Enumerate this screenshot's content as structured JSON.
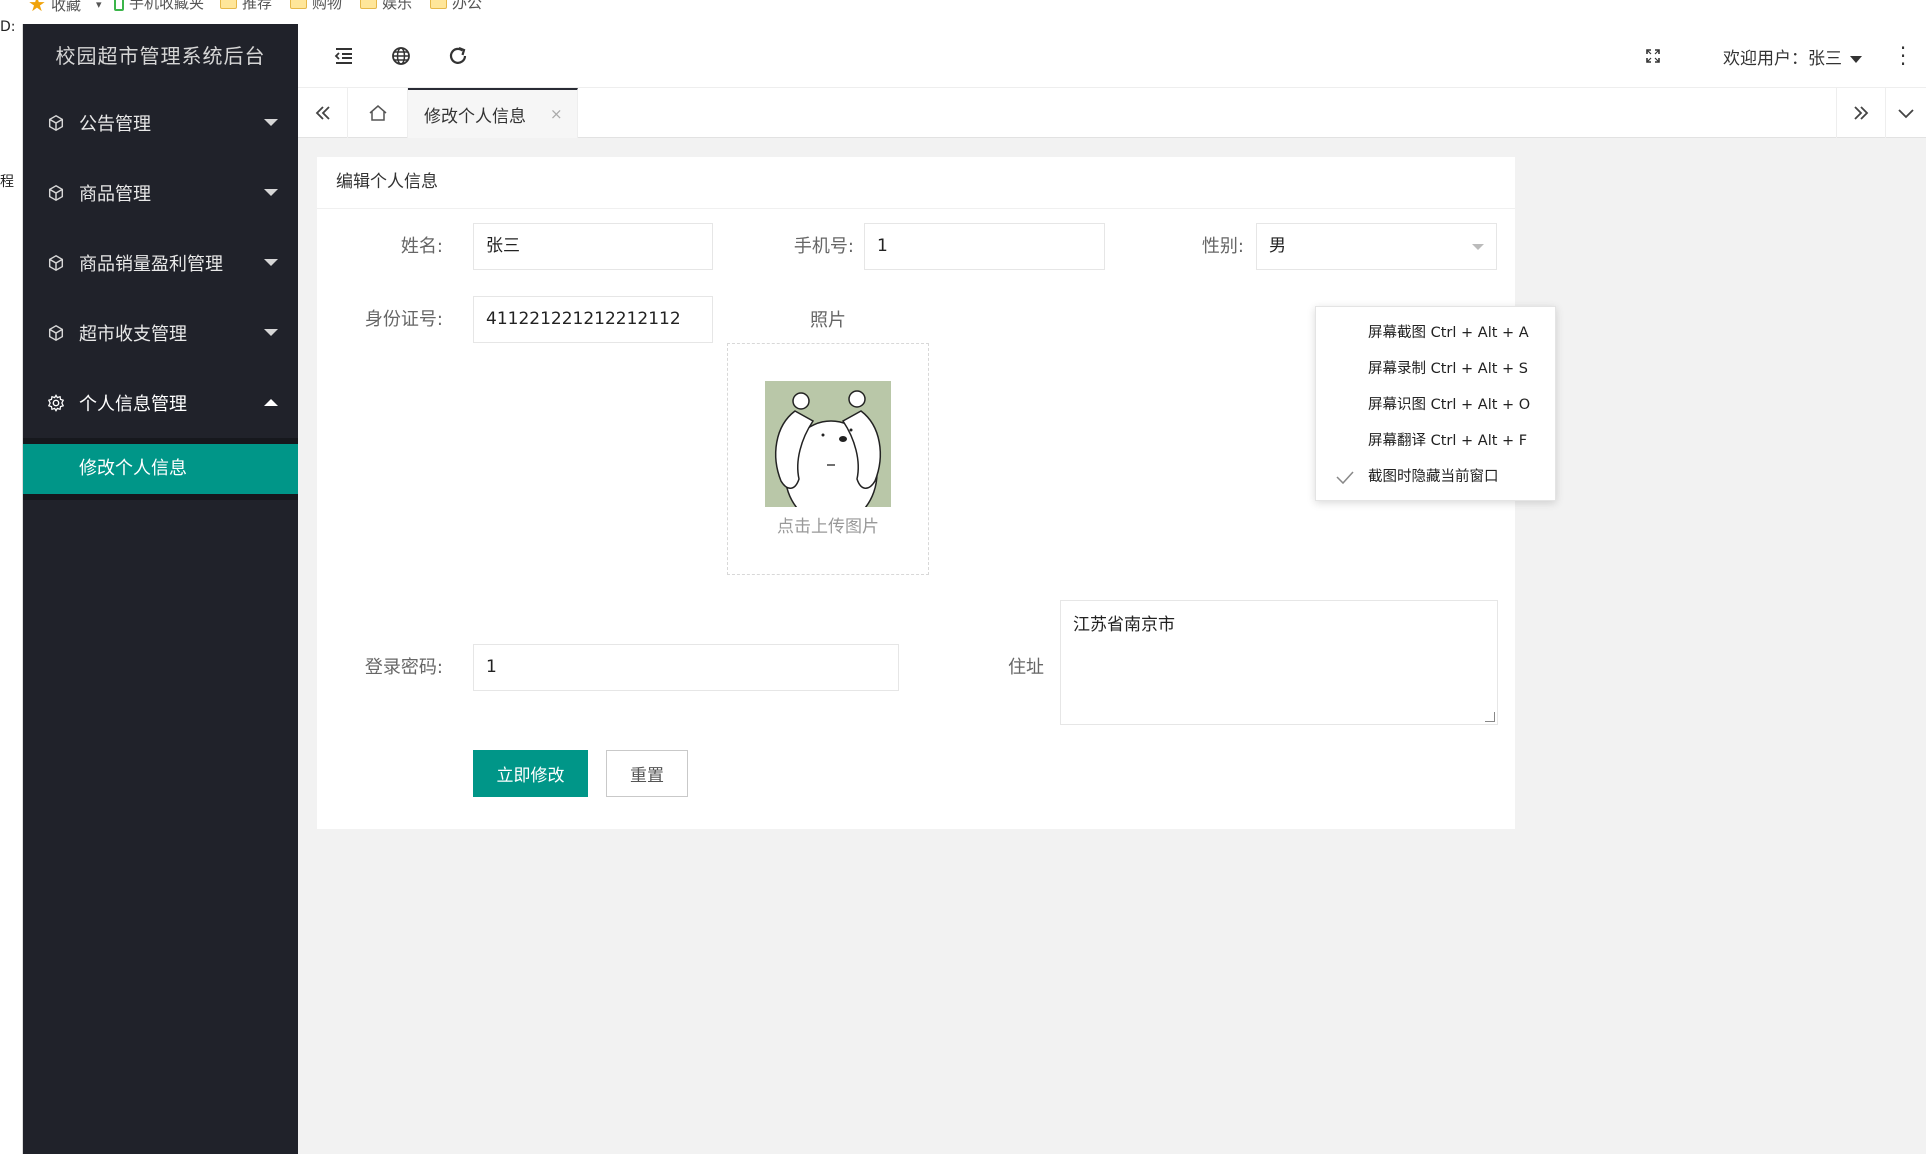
{
  "browser": {
    "bookmarks": [
      {
        "label": "收藏",
        "icon": "star-icon"
      },
      {
        "label": "手机收藏夹",
        "icon": "phone-icon"
      },
      {
        "label": "推荐",
        "icon": "folder-icon"
      },
      {
        "label": "购物",
        "icon": "folder-icon"
      },
      {
        "label": "娱乐",
        "icon": "folder-icon"
      },
      {
        "label": "办公",
        "icon": "folder-icon"
      }
    ],
    "left_strip_fragments": [
      "D:",
      "程"
    ]
  },
  "sidebar": {
    "title": "校园超市管理系统后台",
    "items": [
      {
        "label": "公告管理",
        "icon": "cube-icon",
        "expanded": false
      },
      {
        "label": "商品管理",
        "icon": "cube-icon",
        "expanded": false
      },
      {
        "label": "商品销量盈利管理",
        "icon": "cube-icon",
        "expanded": false
      },
      {
        "label": "超市收支管理",
        "icon": "cube-icon",
        "expanded": false
      },
      {
        "label": "个人信息管理",
        "icon": "gear-icon",
        "expanded": true
      }
    ],
    "subitems": [
      {
        "label": "修改个人信息",
        "active": true
      }
    ],
    "bg_color": "#20222a",
    "active_color": "#009688"
  },
  "header": {
    "icons": [
      "menu-indent-icon",
      "globe-icon",
      "refresh-icon",
      "fullscreen-icon",
      "more-vertical-icon"
    ],
    "welcome_text": "欢迎用户：张三"
  },
  "tabs": {
    "active_label": "修改个人信息",
    "close_glyph": "×"
  },
  "form": {
    "card_title": "编辑个人信息",
    "name_label": "姓名:",
    "name_value": "张三",
    "phone_label": "手机号:",
    "phone_value": "1",
    "gender_label": "性别:",
    "gender_value": "男",
    "id_label": "身份证号:",
    "id_value": "411221221212212112",
    "photo_label": "照片",
    "photo_hint": "点击上传图片",
    "password_label": "登录密码:",
    "password_value": "1",
    "address_label": "住址",
    "address_value": "江苏省南京市",
    "submit_label": "立即修改",
    "reset_label": "重置",
    "accent_color": "#009688"
  },
  "context_menu": {
    "items": [
      {
        "label": "屏幕截图 Ctrl + Alt + A",
        "checked": false
      },
      {
        "label": "屏幕录制 Ctrl + Alt + S",
        "checked": false
      },
      {
        "label": "屏幕识图 Ctrl + Alt + O",
        "checked": false
      },
      {
        "label": "屏幕翻译 Ctrl + Alt + F",
        "checked": false
      },
      {
        "label": "截图时隐藏当前窗口",
        "checked": true
      }
    ]
  }
}
